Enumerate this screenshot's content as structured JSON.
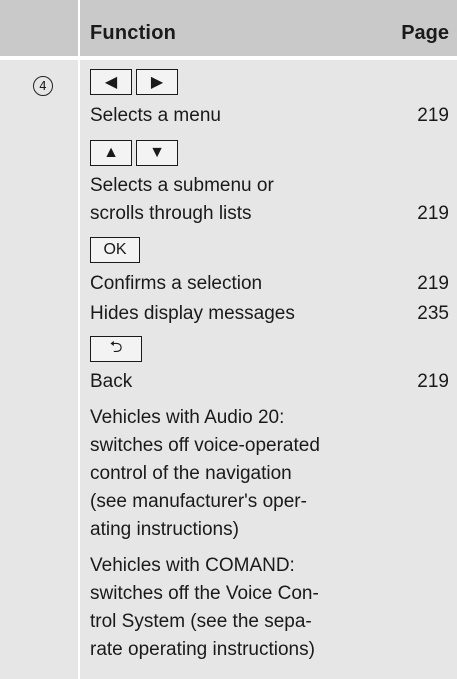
{
  "header": {
    "function_label": "Function",
    "page_label": "Page"
  },
  "row": {
    "number": "4",
    "keys": {
      "left_arrow": "◀",
      "right_arrow": "▶",
      "up_arrow": "▲",
      "down_arrow": "▼",
      "ok": "OK",
      "back": "⮌"
    },
    "entries": [
      {
        "text": "Selects a menu",
        "page": "219"
      },
      {
        "text_lines": [
          "Selects a submenu or",
          "scrolls through lists"
        ],
        "page": "219"
      },
      {
        "text": "Confirms a selection",
        "page": "219"
      },
      {
        "text": "Hides display messages",
        "page": "235"
      },
      {
        "text": "Back",
        "page": "219"
      }
    ],
    "note_audio20": [
      "Vehicles with Audio 20:",
      "switches off voice-operated",
      "control of the navigation",
      "(see manufacturer's oper-",
      "ating instructions)"
    ],
    "note_comand": [
      "Vehicles with COMAND:",
      "switches off the Voice Con-",
      "trol System (see the sepa-",
      "rate operating instructions)"
    ]
  },
  "colors": {
    "header_bg": "#c9c9c9",
    "body_bg": "#e6e6e6",
    "text": "#1a1a1a"
  }
}
